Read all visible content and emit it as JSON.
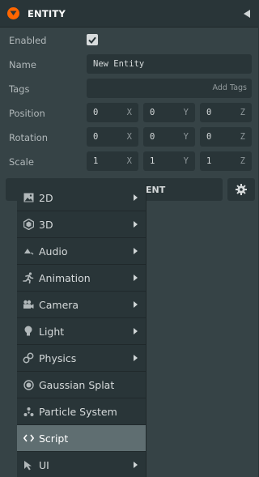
{
  "header": {
    "title": "ENTITY"
  },
  "fields": {
    "enabled": {
      "label": "Enabled",
      "checked": true
    },
    "name": {
      "label": "Name",
      "value": "New Entity"
    },
    "tags": {
      "label": "Tags",
      "add_label": "Add Tags"
    },
    "position": {
      "label": "Position",
      "x": "0",
      "y": "0",
      "z": "0"
    },
    "rotation": {
      "label": "Rotation",
      "x": "0",
      "y": "0",
      "z": "0"
    },
    "scale": {
      "label": "Scale",
      "x": "1",
      "y": "1",
      "z": "1"
    },
    "axes": {
      "x": "X",
      "y": "Y",
      "z": "Z"
    }
  },
  "add_component": {
    "label_visible": "ENT"
  },
  "menu": {
    "items": [
      {
        "label": "2D",
        "icon": "image-icon",
        "submenu": true
      },
      {
        "label": "3D",
        "icon": "cube-icon",
        "submenu": true
      },
      {
        "label": "Audio",
        "icon": "speaker-icon",
        "submenu": true
      },
      {
        "label": "Animation",
        "icon": "running-figure-icon",
        "submenu": true
      },
      {
        "label": "Camera",
        "icon": "camera-icon",
        "submenu": true
      },
      {
        "label": "Light",
        "icon": "bulb-icon",
        "submenu": true
      },
      {
        "label": "Physics",
        "icon": "link-icon",
        "submenu": true
      },
      {
        "label": "Gaussian Splat",
        "icon": "splat-icon",
        "submenu": false
      },
      {
        "label": "Particle System",
        "icon": "particles-icon",
        "submenu": false
      },
      {
        "label": "Script",
        "icon": "code-icon",
        "submenu": false,
        "active": true
      },
      {
        "label": "UI",
        "icon": "cursor-icon",
        "submenu": true
      }
    ]
  },
  "colors": {
    "accent": "#ff6600",
    "panel": "#364346",
    "field": "#293538",
    "active": "#5f6e71"
  }
}
